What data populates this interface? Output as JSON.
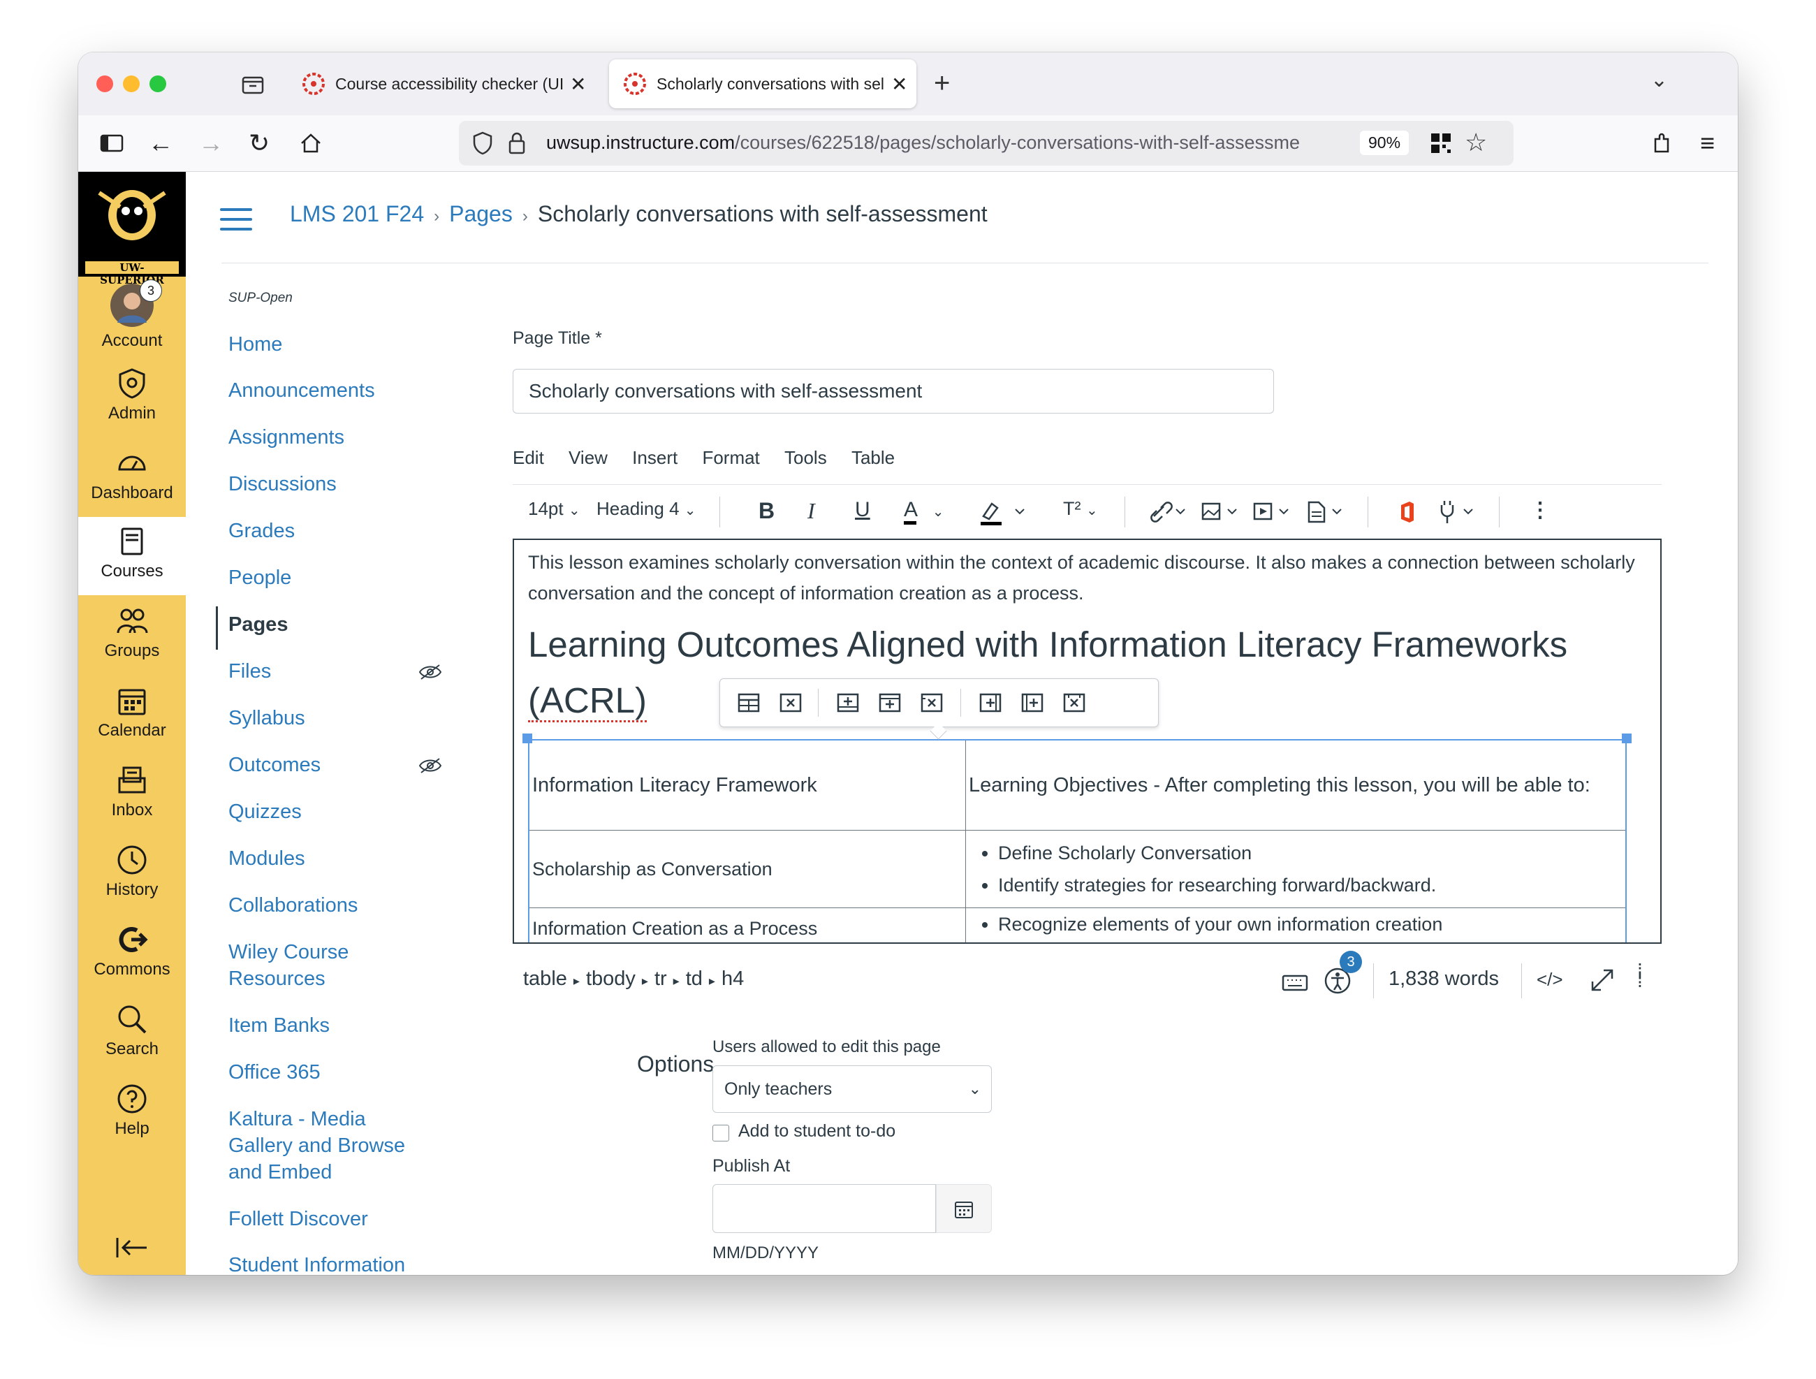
{
  "browser": {
    "tabs": [
      {
        "title": "Course accessibility checker (UI",
        "active": false
      },
      {
        "title": "Scholarly conversations with sel",
        "active": true
      }
    ],
    "url_host": "uwsup.instructure.com",
    "url_path": "/courses/622518/pages/scholarly-conversations-with-self-assessme",
    "zoom": "90%"
  },
  "global_nav": {
    "logo_text": "UW-SUPERIOR",
    "badge": "3",
    "items": [
      "Account",
      "Admin",
      "Dashboard",
      "Courses",
      "Groups",
      "Calendar",
      "Inbox",
      "History",
      "Commons",
      "Search",
      "Help"
    ],
    "active": "Courses"
  },
  "breadcrumb": {
    "course": "LMS 201 F24",
    "section": "Pages",
    "current": "Scholarly conversations with self-assessment"
  },
  "course_nav": {
    "sub_label": "SUP-Open",
    "items": [
      "Home",
      "Announcements",
      "Assignments",
      "Discussions",
      "Grades",
      "People",
      "Pages",
      "Files",
      "Syllabus",
      "Outcomes",
      "Quizzes",
      "Modules",
      "Collaborations",
      "Wiley Course Resources",
      "Item Banks",
      "Office 365",
      "Kaltura - Media Gallery and Browse and Embed",
      "Follett Discover",
      "Student Information"
    ],
    "active": "Pages"
  },
  "editor": {
    "page_title_label": "Page Title",
    "required_mark": "*",
    "page_title_value": "Scholarly conversations with self-assessment",
    "menus": [
      "Edit",
      "View",
      "Insert",
      "Format",
      "Tools",
      "Table"
    ],
    "font_size": "14pt",
    "block_format": "Heading 4",
    "superscript_label": "T²",
    "intro": "This lesson examines scholarly conversation within the context of academic discourse. It also makes a connection between scholarly conversation and the concept of information creation as a process.",
    "heading_main": "Learning Outcomes Aligned with Information Literacy Frameworks ",
    "heading_acronym": "(ACRL)",
    "table": {
      "col1_header": "Information Literacy Framework",
      "col2_header": "Learning Objectives - After completing this lesson, you will be able to:",
      "row1_label": "Scholarship as Conversation",
      "row1_bullets": [
        "Define Scholarly Conversation",
        "Identify strategies for researching forward/backward."
      ],
      "row2_label": "Information Creation as a Process",
      "row2_bullets": [
        "Recognize elements of your own information creation"
      ]
    },
    "status_path": [
      "table",
      "tbody",
      "tr",
      "td",
      "h4"
    ],
    "a11y_badge": "3",
    "word_count": "1,838 words",
    "html_toggle": "</>"
  },
  "options": {
    "label": "Options",
    "users_label": "Users allowed to edit this page",
    "users_value": "Only teachers",
    "todo_label": "Add to student to-do",
    "publish_label": "Publish At",
    "date_hint": "MM/DD/YYYY"
  },
  "colors": {
    "link": "#2b7abc",
    "text": "#2d3b45",
    "nav_bg": "#f5cc60",
    "table_select": "#5c9be6"
  }
}
